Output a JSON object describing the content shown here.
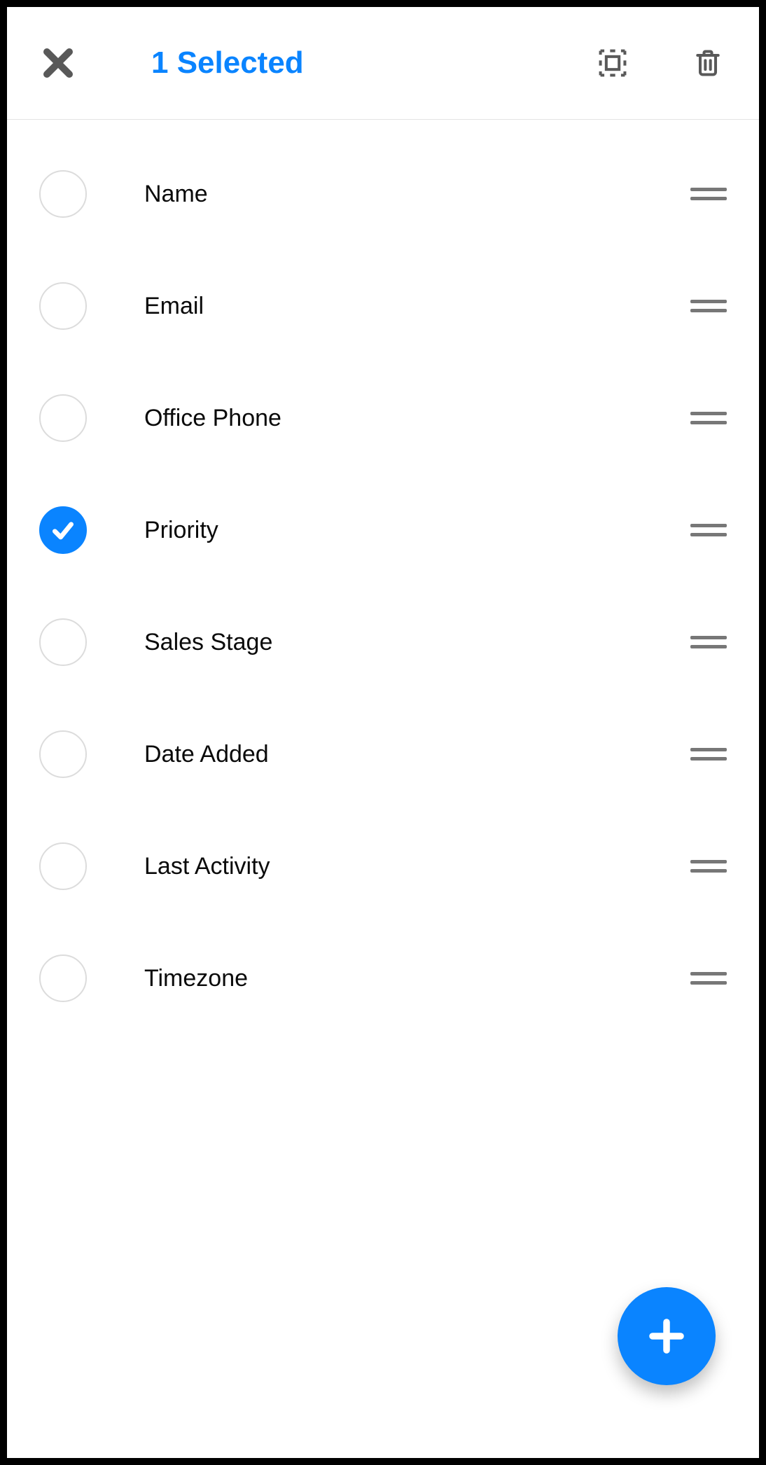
{
  "colors": {
    "accent": "#0a84ff",
    "icon_gray": "#595959",
    "circle_border": "#dcdcdc",
    "text": "#0a0a0a"
  },
  "header": {
    "title": "1 Selected"
  },
  "list": {
    "items": [
      {
        "label": "Name",
        "selected": false
      },
      {
        "label": "Email",
        "selected": false
      },
      {
        "label": "Office Phone",
        "selected": false
      },
      {
        "label": "Priority",
        "selected": true
      },
      {
        "label": "Sales Stage",
        "selected": false
      },
      {
        "label": "Date Added",
        "selected": false
      },
      {
        "label": "Last Activity",
        "selected": false
      },
      {
        "label": "Timezone",
        "selected": false
      }
    ]
  }
}
